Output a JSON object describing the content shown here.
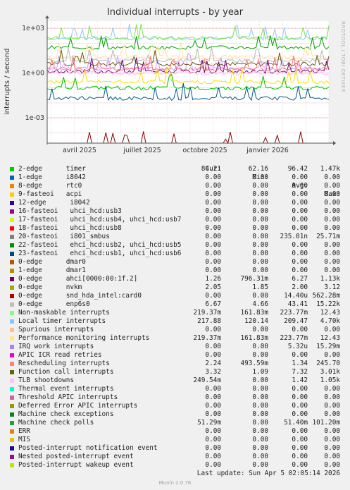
{
  "title": "Individual interrupts - by year",
  "side_credit": "RRDTOOL / TOBI OETIKER",
  "y_axis_label": "interrupts / second",
  "chart_data": {
    "type": "line",
    "title": "Individual interrupts - by year",
    "ylabel": "interrupts / second",
    "y_scale": "log",
    "ylim": [
      2e-05,
      3000
    ],
    "y_ticks": [
      {
        "value": 1000,
        "label": "1e+03"
      },
      {
        "value": 1,
        "label": "1e+00"
      },
      {
        "value": 0.001,
        "label": "1e-03"
      }
    ],
    "x_ticks": [
      "avril 2025",
      "juillet 2025",
      "octobre 2025",
      "janvier 2026"
    ],
    "grid": true,
    "series": [
      {
        "name": "Local timer interrupts",
        "color": "#8fc8ff",
        "level": 209.47
      },
      {
        "name": "Non-maskable interrupts",
        "color": "#7ee34c",
        "level": 223.77
      },
      {
        "name": "Machine check polls",
        "color": "#00a000",
        "level": 51.4
      },
      {
        "name": "Performance monitoring interrupts",
        "color": "#ffe099",
        "level": 12
      },
      {
        "name": "0-edge nvkm",
        "color": "#c2a0ff",
        "level": 2.0
      },
      {
        "name": "0-edge enp6s0",
        "color": "#b8b8b8",
        "level": 6.67
      },
      {
        "name": "Function call interrupts",
        "color": "#6e5b16",
        "level": 4.0
      },
      {
        "name": "0-edge ahci[0000:00:1f.2]",
        "color": "#7a0070",
        "level": 1.26
      },
      {
        "name": "Rescheduling interrupts",
        "color": "#ff7070",
        "level": 1.8
      },
      {
        "name": "TLB shootdowns",
        "color": "#ffbfff",
        "level": 1.0
      },
      {
        "name": "9-fasteoi acpi",
        "color": "#ffdd00",
        "level": 0.25
      },
      {
        "name": "2-edge timer",
        "color": "#00c000",
        "level": 0.1
      },
      {
        "name": "22-fasteoi ehci_hcd:usb2, uhci_hcd:usb5",
        "color": "#005a8a",
        "level": 0.02
      },
      {
        "name": "0-edge snd_hda_intel:card0",
        "color": "#8a0000",
        "level": 1.44e-05
      }
    ]
  },
  "legend_header": {
    "cur": "Cur:",
    "min": "Min:",
    "avg": "Avg:",
    "max": "Max:"
  },
  "legend": [
    {
      "name": "2-edge      timer",
      "color": "#00cc00",
      "cur": "84.21",
      "min": "62.16",
      "avg": "96.42",
      "max": "1.47k"
    },
    {
      "name": "1-edge      i8042",
      "color": "#0066b3",
      "cur": "0.00",
      "min": "0.00",
      "avg": "0.00",
      "max": "0.00"
    },
    {
      "name": "8-edge      rtc0",
      "color": "#ff8000",
      "cur": "0.00",
      "min": "0.00",
      "avg": "0.00",
      "max": "0.00"
    },
    {
      "name": "9-fasteoi   acpi",
      "color": "#ffcc00",
      "cur": "0.00",
      "min": "0.00",
      "avg": "0.00",
      "max": "0.00"
    },
    {
      "name": "12-edge      i8042",
      "color": "#330099",
      "cur": "0.00",
      "min": "0.00",
      "avg": "0.00",
      "max": "0.00"
    },
    {
      "name": "16-fasteoi   uhci_hcd:usb3",
      "color": "#990099",
      "cur": "0.00",
      "min": "0.00",
      "avg": "0.00",
      "max": "0.00"
    },
    {
      "name": "17-fasteoi   uhci_hcd:usb4, uhci_hcd:usb7",
      "color": "#ccff00",
      "cur": "0.00",
      "min": "0.00",
      "avg": "0.00",
      "max": "0.00"
    },
    {
      "name": "18-fasteoi   uhci_hcd:usb8",
      "color": "#ff0000",
      "cur": "0.00",
      "min": "0.00",
      "avg": "0.00",
      "max": "0.00"
    },
    {
      "name": "20-fasteoi   i801_smbus",
      "color": "#808080",
      "cur": "0.00",
      "min": "0.00",
      "avg": "235.01n",
      "max": "25.71m"
    },
    {
      "name": "22-fasteoi   ehci_hcd:usb2, uhci_hcd:usb5",
      "color": "#008f00",
      "cur": "0.00",
      "min": "0.00",
      "avg": "0.00",
      "max": "0.00"
    },
    {
      "name": "23-fasteoi   ehci_hcd:usb1, uhci_hcd:usb6",
      "color": "#00487d",
      "cur": "0.00",
      "min": "0.00",
      "avg": "0.00",
      "max": "0.00"
    },
    {
      "name": "0-edge      dmar0",
      "color": "#b35a00",
      "cur": "0.00",
      "min": "0.00",
      "avg": "0.00",
      "max": "0.00"
    },
    {
      "name": "1-edge      dmar1",
      "color": "#b38f00",
      "cur": "0.00",
      "min": "0.00",
      "avg": "0.00",
      "max": "0.00"
    },
    {
      "name": "0-edge      ahci[0000:00:1f.2]",
      "color": "#6b006b",
      "cur": "1.26",
      "min": "796.31m",
      "avg": "6.27",
      "max": "1.13k"
    },
    {
      "name": "0-edge      nvkm",
      "color": "#8fb300",
      "cur": "2.05",
      "min": "1.85",
      "avg": "2.00",
      "max": "3.12"
    },
    {
      "name": "0-edge      snd_hda_intel:card0",
      "color": "#b30000",
      "cur": "0.00",
      "min": "0.00",
      "avg": "14.40u",
      "max": "562.28m"
    },
    {
      "name": "0-edge      enp6s0",
      "color": "#bebebe",
      "cur": "6.67",
      "min": "4.66",
      "avg": "43.41",
      "max": "15.22k"
    },
    {
      "name": "Non-maskable interrupts",
      "color": "#80ff80",
      "cur": "219.37m",
      "min": "161.83m",
      "avg": "223.77m",
      "max": "12.43"
    },
    {
      "name": "Local timer interrupts",
      "color": "#80c9ff",
      "cur": "217.88",
      "min": "120.14",
      "avg": "209.47",
      "max": "4.70k"
    },
    {
      "name": "Spurious interrupts",
      "color": "#ffc080",
      "cur": "0.00",
      "min": "0.00",
      "avg": "0.00",
      "max": "0.00"
    },
    {
      "name": "Performance monitoring interrupts",
      "color": "#ffe680",
      "cur": "219.37m",
      "min": "161.83m",
      "avg": "223.77m",
      "max": "12.43"
    },
    {
      "name": "IRQ work interrupts",
      "color": "#aa80ff",
      "cur": "0.00",
      "min": "0.00",
      "avg": "5.32u",
      "max": "15.29m"
    },
    {
      "name": "APIC ICR read retries",
      "color": "#ee00cc",
      "cur": "0.00",
      "min": "0.00",
      "avg": "0.00",
      "max": "0.00"
    },
    {
      "name": "Rescheduling interrupts",
      "color": "#ff8080",
      "cur": "2.24",
      "min": "493.59m",
      "avg": "1.34",
      "max": "245.70"
    },
    {
      "name": "Function call interrupts",
      "color": "#666600",
      "cur": "3.32",
      "min": "1.09",
      "avg": "7.32",
      "max": "3.01k"
    },
    {
      "name": "TLB shootdowns",
      "color": "#ffbfff",
      "cur": "249.54m",
      "min": "0.00",
      "avg": "1.42",
      "max": "1.05k"
    },
    {
      "name": "Thermal event interrupts",
      "color": "#00ffcc",
      "cur": "0.00",
      "min": "0.00",
      "avg": "0.00",
      "max": "0.00"
    },
    {
      "name": "Threshold APIC interrupts",
      "color": "#cc6699",
      "cur": "0.00",
      "min": "0.00",
      "avg": "0.00",
      "max": "0.00"
    },
    {
      "name": "Deferred Error APIC interrupts",
      "color": "#999900",
      "cur": "0.00",
      "min": "0.00",
      "avg": "0.00",
      "max": "0.00"
    },
    {
      "name": "Machine check exceptions",
      "color": "#0f7f1f",
      "cur": "0.00",
      "min": "0.00",
      "avg": "0.00",
      "max": "0.00"
    },
    {
      "name": "Machine check polls",
      "color": "#1f9f3f",
      "cur": "51.29m",
      "min": "0.00",
      "avg": "51.40m",
      "max": "101.20m"
    },
    {
      "name": "ERR",
      "color": "#e6820a",
      "cur": "0.00",
      "min": "0.00",
      "avg": "0.00",
      "max": "0.00"
    },
    {
      "name": "MIS",
      "color": "#e6c50a",
      "cur": "0.00",
      "min": "0.00",
      "avg": "0.00",
      "max": "0.00"
    },
    {
      "name": "Posted-interrupt notification event",
      "color": "#1a0a99",
      "cur": "0.00",
      "min": "0.00",
      "avg": "0.00",
      "max": "0.00"
    },
    {
      "name": "Nested posted-interrupt event",
      "color": "#990a99",
      "cur": "0.00",
      "min": "0.00",
      "avg": "0.00",
      "max": "0.00"
    },
    {
      "name": "Posted-interrupt wakeup event",
      "color": "#b8e600",
      "cur": "0.00",
      "min": "0.00",
      "avg": "0.00",
      "max": "0.00"
    }
  ],
  "last_update": "Last update: Sun Apr  5 02:05:14 2026",
  "munin_version": "Munin 2.0.76"
}
